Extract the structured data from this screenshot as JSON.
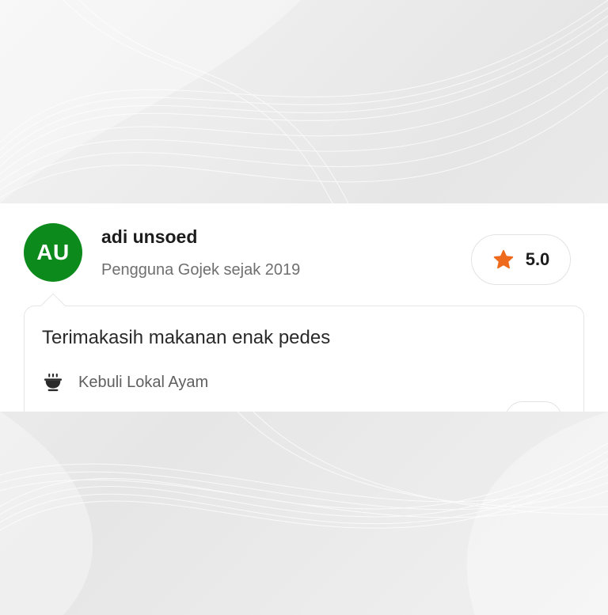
{
  "review": {
    "avatar_initials": "AU",
    "user_name": "adi unsoed",
    "user_since": "Pengguna Gojek sejak 2019",
    "rating": "5.0",
    "comment": "Terimakasih makanan enak pedes",
    "dish_name": "Kebuli Lokal Ayam",
    "icons": {
      "rating": "star-icon",
      "dish": "food-bowl-icon"
    }
  },
  "colors": {
    "avatar_bg": "#0d8a1c",
    "star": "#ee6a1c",
    "background": "#ededed",
    "card_bg": "#ffffff"
  }
}
